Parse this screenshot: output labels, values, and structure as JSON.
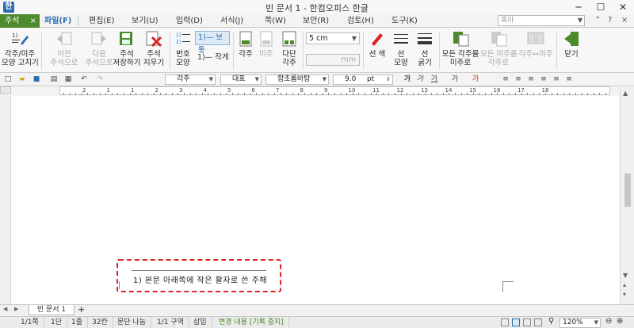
{
  "window": {
    "title": "빈 문서 1 - 한컴오피스 한글",
    "app_icon": "한",
    "controls": {
      "minimize": "─",
      "maximize": "☐",
      "close": "✕"
    }
  },
  "menubar": {
    "active_tab": "주석",
    "active_close": "×",
    "items": [
      {
        "label": "파일(F)"
      },
      {
        "label": "편집(E)"
      },
      {
        "label": "보기(U)"
      },
      {
        "label": "입력(D)"
      },
      {
        "label": "서식(J)"
      },
      {
        "label": "쪽(W)"
      },
      {
        "label": "보안(R)"
      },
      {
        "label": "검토(H)"
      },
      {
        "label": "도구(K)"
      }
    ],
    "search_placeholder": "혹아",
    "right_icons": [
      "⌃",
      "?",
      "×"
    ]
  },
  "ribbon": {
    "edit_footnote": "각주/미주\n모양 고치기",
    "prev_note": "이전\n주석으로",
    "next_note": "다음\n주석으로",
    "save_note": "주석\n저장하기",
    "delete_note": "주석\n지우기",
    "number_shape": "번호\n모양",
    "style_normal": "1)— 보통",
    "style_small": "1)— 작게",
    "footnote": "각주",
    "endnote": "미주",
    "multi_col": "다단\n각주",
    "size_value": "5 cm",
    "mm_value": "mm",
    "line_color": "선 색",
    "line_shape": "선\n모양",
    "line_thickness": "선\n굵기",
    "all_to_endnote": "모든 각주를\n미주로",
    "all_to_footnote": "모든 미주를\n각주로",
    "swap": "각주↔미주",
    "close": "닫기"
  },
  "format_bar": {
    "style": "각주",
    "lang": "대표",
    "font": "함초롬바탕",
    "size": "9.0",
    "unit": "pt",
    "bold": "가",
    "italic": "가",
    "underline": "가"
  },
  "ruler": {
    "numbers": [
      "2",
      "1",
      "1",
      "2",
      "3",
      "4",
      "5",
      "6",
      "7",
      "8",
      "9",
      "10",
      "11",
      "12",
      "13",
      "14",
      "15",
      "16",
      "17",
      "18"
    ]
  },
  "document": {
    "footnote_text": "1) 본문 아래쪽에 작은 활자로 쓴 주해"
  },
  "tabbar": {
    "doc_tab": "빈 문서 1",
    "add": "+"
  },
  "statusbar": {
    "page": "1/1쪽",
    "column": "1단",
    "line": "1줄",
    "col": "32칸",
    "para": "문단 나눔",
    "section": "1/1 구역",
    "insert": "삽입",
    "track": "변경 내용 [기록 중지]",
    "zoom": "120%"
  },
  "colors": {
    "accent": "#4c8a2b",
    "highlight_box": "#dd2222"
  }
}
